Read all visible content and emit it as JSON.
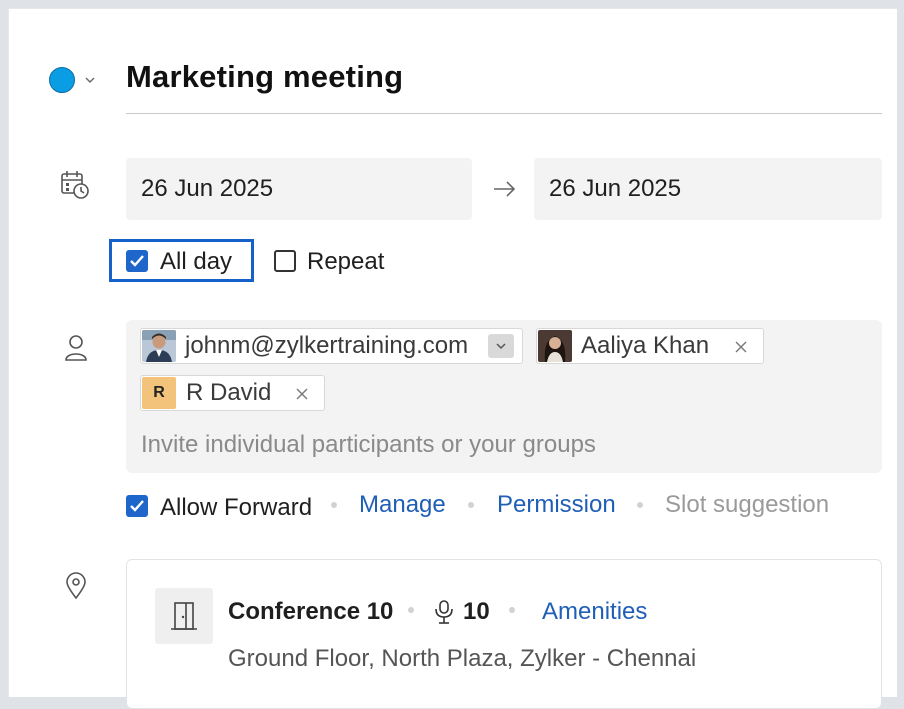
{
  "event": {
    "title": "Marketing meeting",
    "color": "#0b9de3"
  },
  "dates": {
    "start": "26 Jun 2025",
    "end": "26 Jun 2025"
  },
  "options": {
    "all_day_label": "All day",
    "all_day_checked": true,
    "repeat_label": "Repeat",
    "repeat_checked": false
  },
  "participants": {
    "chips": [
      {
        "label": "johnm@zylkertraining.com",
        "avatar": "photo"
      },
      {
        "label": "Aaliya Khan",
        "avatar": "photo"
      },
      {
        "label": "R David",
        "avatar_initial": "R"
      }
    ],
    "invite_placeholder": "Invite individual participants or your groups"
  },
  "participant_actions": {
    "allow_forward_label": "Allow Forward",
    "allow_forward_checked": true,
    "manage_label": "Manage",
    "permission_label": "Permission",
    "slot_suggestion_label": "Slot suggestion"
  },
  "location": {
    "room_name": "Conference 10",
    "capacity": "10",
    "amenities_label": "Amenities",
    "address": "Ground Floor, North Plaza, Zylker - Chennai"
  },
  "colors": {
    "accent": "#1e66c9",
    "link": "#1f5fb5",
    "event_color": "#0b9de3"
  },
  "icons": [
    "chevron-down-icon",
    "calendar-clock-icon",
    "arrow-right-icon",
    "person-icon",
    "close-icon",
    "location-pin-icon",
    "door-icon",
    "podium-icon"
  ]
}
